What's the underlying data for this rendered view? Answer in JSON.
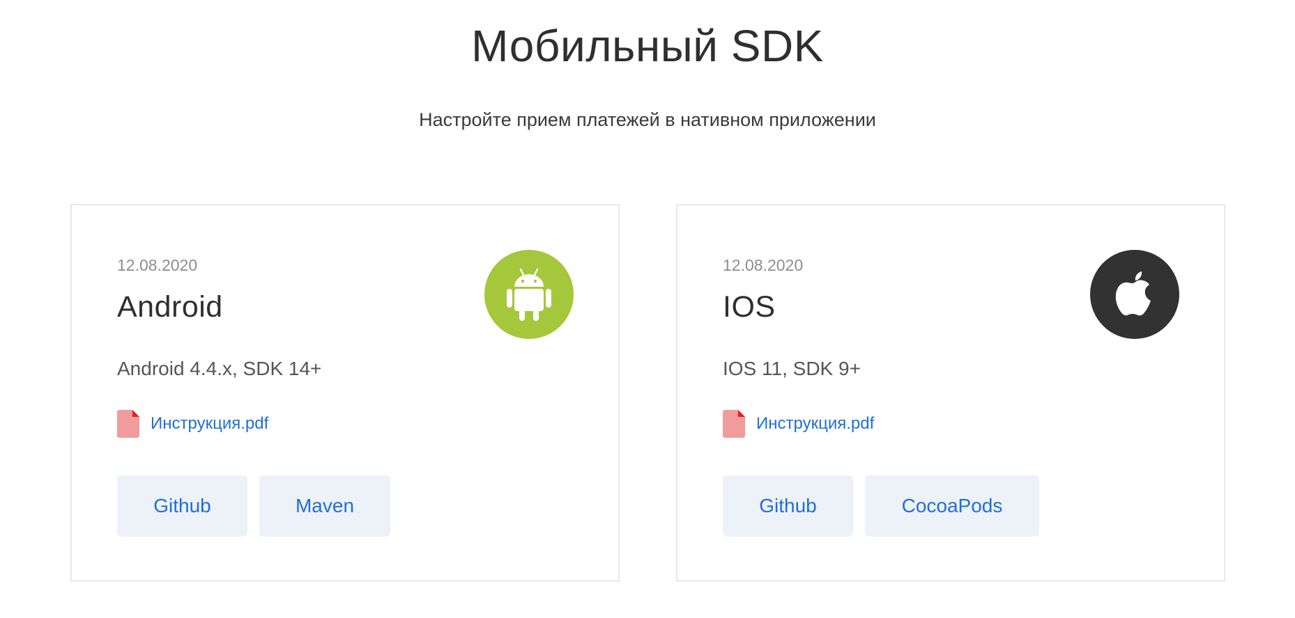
{
  "header": {
    "title": "Мобильный SDK",
    "subtitle": "Настройте прием платежей в нативном приложении"
  },
  "cards": [
    {
      "date": "12.08.2020",
      "title": "Android",
      "version": "Android 4.4.x, SDK 14+",
      "doc_label": "Инструкция.pdf",
      "logo_icon": "android-icon",
      "logo_color": "#a4c73b",
      "buttons": [
        "Github",
        "Maven"
      ]
    },
    {
      "date": "12.08.2020",
      "title": "IOS",
      "version": "IOS 11, SDK 9+",
      "doc_label": "Инструкция.pdf",
      "logo_icon": "apple-icon",
      "logo_color": "#323232",
      "buttons": [
        "Github",
        "CocoaPods"
      ]
    }
  ],
  "colors": {
    "link": "#1f6fd6",
    "button_bg": "#edf1f8",
    "pdf_icon": "#f09c9c",
    "pdf_corner": "#e21f26",
    "card_border": "#e6e8ec"
  }
}
